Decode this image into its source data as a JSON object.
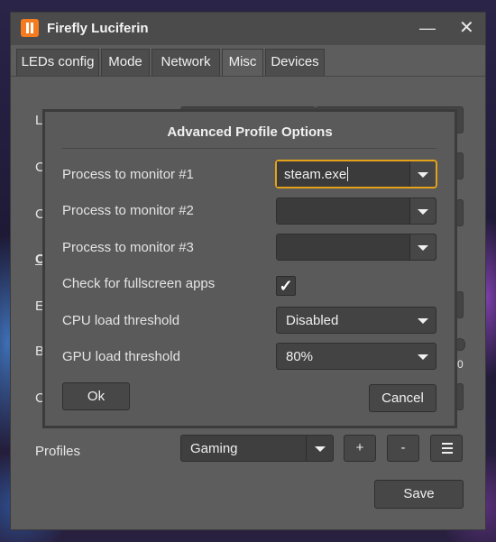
{
  "window": {
    "title": "Firefly Luciferin",
    "icon": "app-logo-icon",
    "minimize_symbol": "—",
    "close_symbol": "✕"
  },
  "tabs": [
    {
      "label": "LEDs config",
      "active": false
    },
    {
      "label": "Mode",
      "active": false
    },
    {
      "label": "Network",
      "active": false
    },
    {
      "label": "Misc",
      "active": true
    },
    {
      "label": "Devices",
      "active": false
    }
  ],
  "background_letters": [
    "L",
    "C",
    "C",
    "C",
    "E",
    "B",
    "C"
  ],
  "background_value_fragment": "0",
  "profiles": {
    "label": "Profiles",
    "selected": "Gaming",
    "add_label": "+",
    "remove_label": "-"
  },
  "save_label": "Save",
  "dialog": {
    "title": "Advanced Profile Options",
    "rows": {
      "process1_label": "Process to monitor #1",
      "process1_value": "steam.exe",
      "process2_label": "Process to monitor #2",
      "process2_value": "",
      "process3_label": "Process to monitor #3",
      "process3_value": "",
      "fullscreen_label": "Check for fullscreen apps",
      "fullscreen_checked": true,
      "fullscreen_mark": "✓",
      "cpu_label": "CPU load threshold",
      "cpu_value": "Disabled",
      "gpu_label": "GPU load threshold",
      "gpu_value": "80%"
    },
    "ok_label": "Ok",
    "cancel_label": "Cancel"
  },
  "colors": {
    "accent_focus": "#e3a21a",
    "app_icon": "#f47b20",
    "window_bg": "#5d5d5d"
  }
}
